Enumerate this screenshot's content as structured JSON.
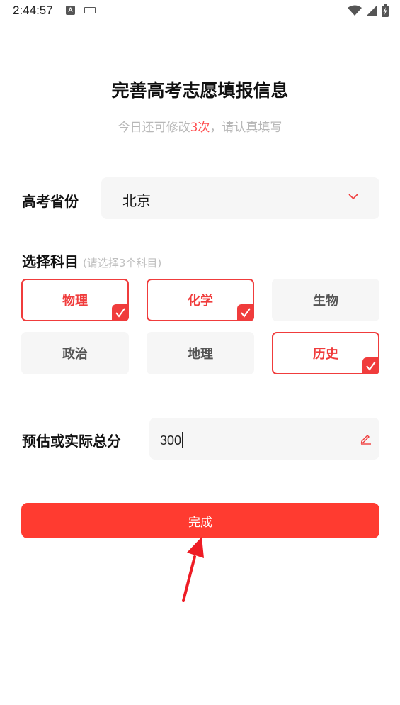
{
  "status_bar": {
    "time": "2:44:57",
    "a_badge": "A"
  },
  "header": {
    "title": "完善高考志愿填报信息",
    "subtitle_prefix": "今日还可修改",
    "subtitle_count": "3次",
    "subtitle_suffix": "，请认真填写"
  },
  "province": {
    "label": "高考省份",
    "value": "北京"
  },
  "subjects": {
    "label": "选择科目",
    "hint": "(请选择3个科目)",
    "items": [
      {
        "label": "物理",
        "selected": true
      },
      {
        "label": "化学",
        "selected": true
      },
      {
        "label": "生物",
        "selected": false
      },
      {
        "label": "政治",
        "selected": false
      },
      {
        "label": "地理",
        "selected": false
      },
      {
        "label": "历史",
        "selected": true
      }
    ]
  },
  "score": {
    "label": "预估或实际总分",
    "value": "300"
  },
  "actions": {
    "done_label": "完成"
  },
  "colors": {
    "accent": "#ff3b30",
    "selected_border": "#f03c3c",
    "subtitle_highlight": "#ff4d4f",
    "field_bg": "#f6f6f6"
  }
}
